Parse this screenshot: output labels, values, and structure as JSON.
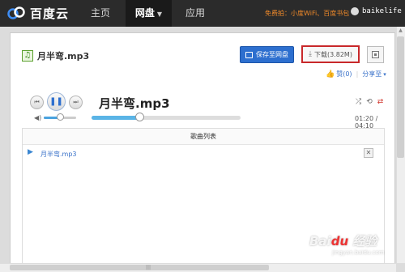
{
  "app": {
    "logo_text": "百度云",
    "colors": {
      "nav_bg": "#2b2b2b",
      "accent": "#2d6fcf",
      "promo": "#f08a2a",
      "highlight_border": "#c8282a"
    }
  },
  "nav": {
    "tabs": [
      {
        "label": "主页",
        "active": false
      },
      {
        "label": "网盘",
        "active": true
      },
      {
        "label": "应用",
        "active": false
      }
    ],
    "promo_prefix": "免费拍：",
    "promo_link1": "小度WiFi",
    "promo_sep": "、",
    "promo_link2": "百度书包",
    "username": "baikelife"
  },
  "file": {
    "name": "月半弯.mp3",
    "save_label": "保存至网盘",
    "download_label": "下载(3.82M)",
    "like_label": "赞(0)",
    "share_label": "分享至"
  },
  "player": {
    "title": "月半弯.mp3",
    "time": "01:20 / 04:10",
    "progress": 0.32,
    "volume": 0.5,
    "icons": [
      "prev-icon",
      "pause-icon",
      "next-icon",
      "volume-icon",
      "shuffle-icon",
      "loop-icon",
      "repeat-icon"
    ]
  },
  "playlist": {
    "header": "歌曲列表",
    "items": [
      {
        "name": "月半弯.mp3"
      }
    ]
  }
}
